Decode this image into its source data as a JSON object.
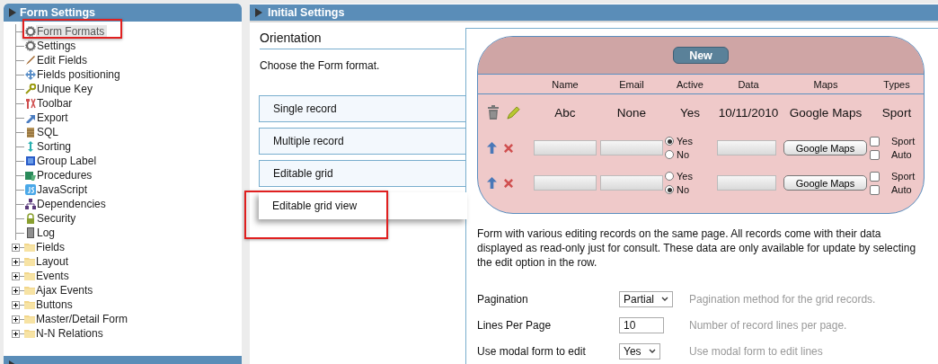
{
  "sidebar": {
    "title": "Form Settings",
    "items": [
      {
        "label": "Form Formats",
        "kind": "leaf",
        "selected": true
      },
      {
        "label": "Settings",
        "kind": "leaf",
        "selected": false
      },
      {
        "label": "Edit Fields",
        "kind": "leaf",
        "selected": false
      },
      {
        "label": "Fields positioning",
        "kind": "leaf",
        "selected": false
      },
      {
        "label": "Unique Key",
        "kind": "leaf",
        "selected": false
      },
      {
        "label": "Toolbar",
        "kind": "leaf",
        "selected": false
      },
      {
        "label": "Export",
        "kind": "leaf",
        "selected": false
      },
      {
        "label": "SQL",
        "kind": "leaf",
        "selected": false
      },
      {
        "label": "Sorting",
        "kind": "leaf",
        "selected": false
      },
      {
        "label": "Group Label",
        "kind": "leaf",
        "selected": false
      },
      {
        "label": "Procedures",
        "kind": "leaf",
        "selected": false
      },
      {
        "label": "JavaScript",
        "kind": "leaf",
        "selected": false
      },
      {
        "label": "Dependencies",
        "kind": "leaf",
        "selected": false
      },
      {
        "label": "Security",
        "kind": "leaf",
        "selected": false
      },
      {
        "label": "Log",
        "kind": "leaf",
        "selected": false
      },
      {
        "label": "Fields",
        "kind": "folder",
        "expanded": false,
        "selected": false
      },
      {
        "label": "Layout",
        "kind": "folder",
        "expanded": false,
        "selected": false
      },
      {
        "label": "Events",
        "kind": "folder",
        "expanded": false,
        "selected": false
      },
      {
        "label": "Ajax Events",
        "kind": "folder",
        "expanded": false,
        "selected": false
      },
      {
        "label": "Buttons",
        "kind": "folder",
        "expanded": false,
        "selected": false
      },
      {
        "label": "Master/Detail Form",
        "kind": "folder",
        "expanded": false,
        "selected": false
      },
      {
        "label": "N-N Relations",
        "kind": "folder",
        "expanded": false,
        "selected": false
      }
    ]
  },
  "main": {
    "title": "Initial Settings",
    "section": "Orientation",
    "hint": "Choose the Form format.",
    "formats": [
      {
        "label": "Single record",
        "selected": false
      },
      {
        "label": "Multiple record",
        "selected": false
      },
      {
        "label": "Editable grid",
        "selected": false
      },
      {
        "label": "Editable grid view",
        "selected": true
      }
    ],
    "preview": {
      "button": "New",
      "columns": [
        "Name",
        "Email",
        "Active",
        "Data",
        "Maps",
        "Types"
      ],
      "read_row": [
        "Abc",
        "None",
        "Yes",
        "10/11/2010",
        "Google Maps",
        "Sport"
      ],
      "edit_rows": [
        {
          "radios": [
            {
              "label": "Yes",
              "selected": true
            },
            {
              "label": "No",
              "selected": false
            }
          ],
          "maps_button": "Google Maps",
          "checks": [
            {
              "label": "Sport",
              "checked": false
            },
            {
              "label": "Auto",
              "checked": false
            }
          ]
        },
        {
          "radios": [
            {
              "label": "Yes",
              "selected": false
            },
            {
              "label": "No",
              "selected": true
            }
          ],
          "maps_button": "Google Maps",
          "checks": [
            {
              "label": "Sport",
              "checked": false
            },
            {
              "label": "Auto",
              "checked": false
            }
          ]
        }
      ]
    },
    "description": "Form with various editing records on the same page. All records come with their data displayed as read-only just for consult. These data are only available for update by selecting the edit option in the row.",
    "settings": [
      {
        "label": "Pagination",
        "kind": "select",
        "value": "Partial",
        "help": "Pagination method for the grid records."
      },
      {
        "label": "Lines Per Page",
        "kind": "input",
        "value": "10",
        "help": "Number of record lines per page."
      },
      {
        "label": "Use modal form to edit",
        "kind": "select",
        "value": "Yes",
        "help": "Use modal form to edit lines"
      }
    ]
  }
}
